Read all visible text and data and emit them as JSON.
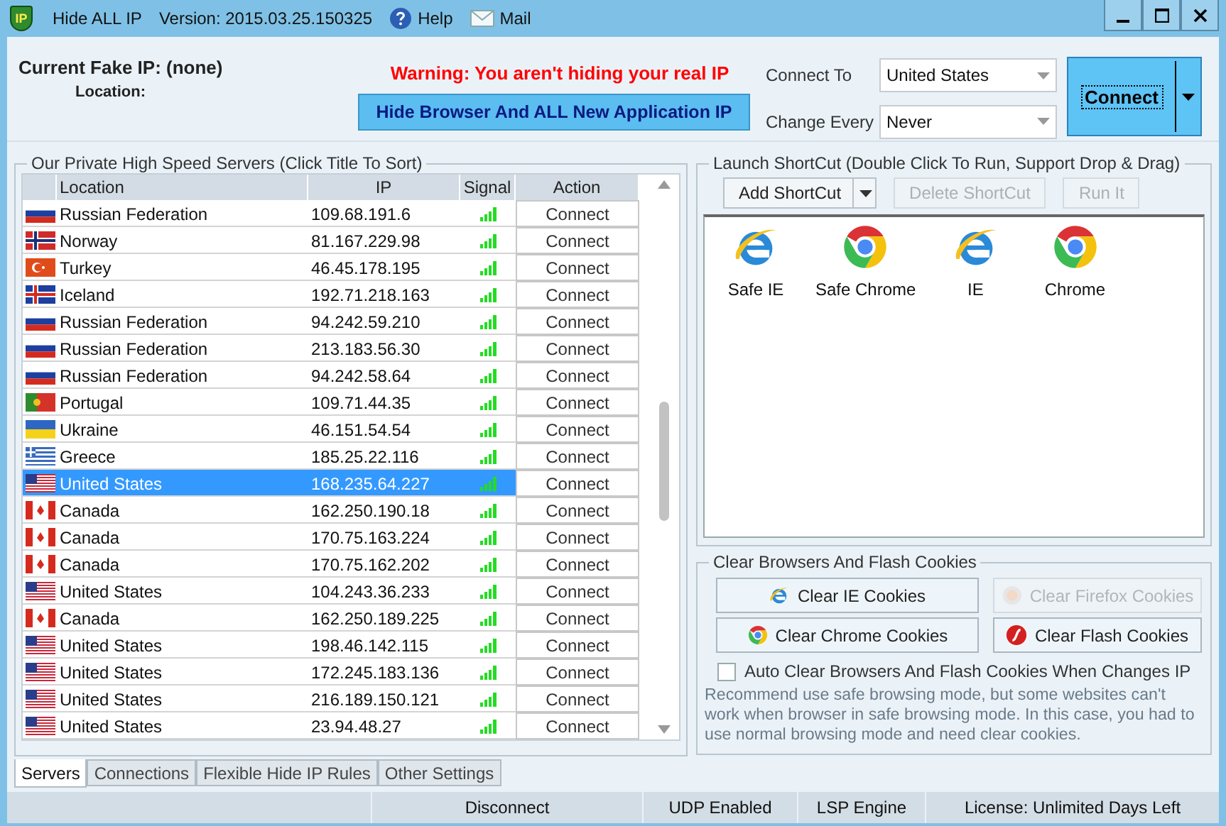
{
  "window": {
    "logo_text": "IP",
    "title": "Hide ALL IP",
    "version": "Version: 2015.03.25.150325",
    "menu": [
      {
        "label": "Help",
        "kind": "help"
      },
      {
        "label": "Mail",
        "kind": "mail"
      }
    ]
  },
  "status": {
    "fake_ip": "Current Fake IP: (none)",
    "location": "Location:",
    "warning": "Warning: You aren't hiding your real IP",
    "hide_button": "Hide Browser And ALL New Application IP"
  },
  "selectors": [
    {
      "label": "Connect To",
      "value": "United States"
    },
    {
      "label": "Change Every",
      "value": "Never"
    }
  ],
  "connect_button": "Connect",
  "servers": {
    "title": "Our Private High Speed Servers (Click Title To Sort)",
    "columns": [
      "Location",
      "IP",
      "Signal",
      "Action"
    ],
    "rows": [
      {
        "kind": "ru",
        "location": "Russian Federation",
        "ip": "109.68.191.6",
        "action": "Connect",
        "selected": false
      },
      {
        "kind": "no",
        "location": "Norway",
        "ip": "81.167.229.98",
        "action": "Connect",
        "selected": false
      },
      {
        "kind": "tr",
        "location": "Turkey",
        "ip": "46.45.178.195",
        "action": "Connect",
        "selected": false
      },
      {
        "kind": "is",
        "location": "Iceland",
        "ip": "192.71.218.163",
        "action": "Connect",
        "selected": false
      },
      {
        "kind": "ru",
        "location": "Russian Federation",
        "ip": "94.242.59.210",
        "action": "Connect",
        "selected": false
      },
      {
        "kind": "ru",
        "location": "Russian Federation",
        "ip": "213.183.56.30",
        "action": "Connect",
        "selected": false
      },
      {
        "kind": "ru",
        "location": "Russian Federation",
        "ip": "94.242.58.64",
        "action": "Connect",
        "selected": false
      },
      {
        "kind": "pt",
        "location": "Portugal",
        "ip": "109.71.44.35",
        "action": "Connect",
        "selected": false
      },
      {
        "kind": "ua",
        "location": "Ukraine",
        "ip": "46.151.54.54",
        "action": "Connect",
        "selected": false
      },
      {
        "kind": "gr",
        "location": "Greece",
        "ip": "185.25.22.116",
        "action": "Connect",
        "selected": false
      },
      {
        "kind": "us",
        "location": "United States",
        "ip": "168.235.64.227",
        "action": "Connect",
        "selected": true
      },
      {
        "kind": "ca",
        "location": "Canada",
        "ip": "162.250.190.18",
        "action": "Connect",
        "selected": false
      },
      {
        "kind": "ca",
        "location": "Canada",
        "ip": "170.75.163.224",
        "action": "Connect",
        "selected": false
      },
      {
        "kind": "ca",
        "location": "Canada",
        "ip": "170.75.162.202",
        "action": "Connect",
        "selected": false
      },
      {
        "kind": "us",
        "location": "United States",
        "ip": "104.243.36.233",
        "action": "Connect",
        "selected": false
      },
      {
        "kind": "ca",
        "location": "Canada",
        "ip": "162.250.189.225",
        "action": "Connect",
        "selected": false
      },
      {
        "kind": "us",
        "location": "United States",
        "ip": "198.46.142.115",
        "action": "Connect",
        "selected": false
      },
      {
        "kind": "us",
        "location": "United States",
        "ip": "172.245.183.136",
        "action": "Connect",
        "selected": false
      },
      {
        "kind": "us",
        "location": "United States",
        "ip": "216.189.150.121",
        "action": "Connect",
        "selected": false
      },
      {
        "kind": "us",
        "location": "United States",
        "ip": "23.94.48.27",
        "action": "Connect",
        "selected": false
      }
    ]
  },
  "tabs": [
    {
      "label": "Servers",
      "selected": true
    },
    {
      "label": "Connections",
      "selected": false
    },
    {
      "label": "Flexible Hide IP Rules",
      "selected": false
    },
    {
      "label": "Other Settings",
      "selected": false
    }
  ],
  "shortcuts": {
    "title": "Launch ShortCut (Double Click To Run, Support Drop & Drag)",
    "buttons": [
      {
        "label": "Add ShortCut",
        "disabled": false,
        "split": true
      },
      {
        "label": "Delete ShortCut",
        "disabled": true,
        "split": false
      },
      {
        "label": "Run It",
        "disabled": true,
        "split": false
      }
    ],
    "items": [
      {
        "label": "Safe IE",
        "kind": "ie"
      },
      {
        "label": "Safe Chrome",
        "kind": "chrome"
      },
      {
        "label": "IE",
        "kind": "ie"
      },
      {
        "label": "Chrome",
        "kind": "chrome"
      }
    ]
  },
  "cookies": {
    "title": "Clear Browsers And Flash Cookies",
    "buttons": [
      {
        "label": "Clear IE Cookies",
        "kind": "ie",
        "disabled": false
      },
      {
        "label": "Clear Firefox Cookies",
        "kind": "firefox",
        "disabled": true
      },
      {
        "label": "Clear Chrome Cookies",
        "kind": "chrome",
        "disabled": false
      },
      {
        "label": "Clear Flash Cookies",
        "kind": "flash",
        "disabled": false
      }
    ],
    "auto_clear": {
      "label": "Auto Clear Browsers And Flash Cookies When Changes IP",
      "checked": false
    },
    "note": "Recommend use safe browsing mode, but some websites can't work when browser in safe browsing mode. In this case, you had to use normal browsing mode and need clear cookies."
  },
  "status_bar": [
    "Disconnect",
    "UDP Enabled",
    "LSP Engine",
    "License: Unlimited Days Left"
  ]
}
